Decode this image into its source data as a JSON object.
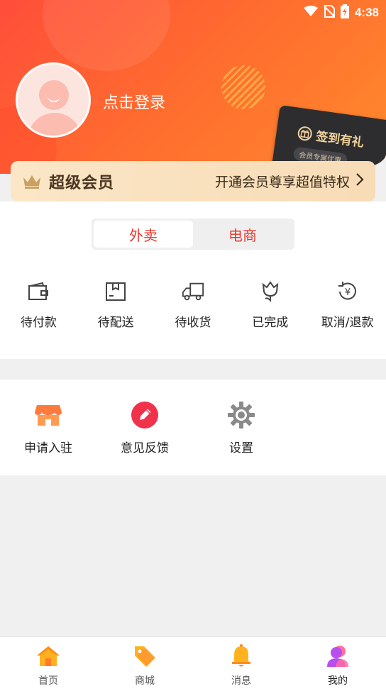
{
  "status_bar": {
    "time": "4:38"
  },
  "profile": {
    "login_text": "点击登录"
  },
  "sign_card": {
    "title": "签到有礼",
    "subtitle": "会员专属优惠"
  },
  "vip": {
    "title": "超级会员",
    "description": "开通会员尊享超值特权"
  },
  "order_tabs": [
    {
      "label": "外卖",
      "selected": true
    },
    {
      "label": "电商",
      "selected": false
    }
  ],
  "orders": [
    {
      "label": "待付款",
      "icon": "wallet-icon"
    },
    {
      "label": "待配送",
      "icon": "package-icon"
    },
    {
      "label": "待收货",
      "icon": "truck-icon"
    },
    {
      "label": "已完成",
      "icon": "flower-icon"
    },
    {
      "label": "取消/退款",
      "icon": "refund-icon"
    }
  ],
  "services": [
    {
      "label": "申请入驻",
      "icon": "shop-icon"
    },
    {
      "label": "意见反馈",
      "icon": "pencil-icon"
    },
    {
      "label": "设置",
      "icon": "gear-icon"
    }
  ],
  "nav": [
    {
      "label": "首页",
      "icon": "home-icon"
    },
    {
      "label": "商城",
      "icon": "tag-icon"
    },
    {
      "label": "消息",
      "icon": "bell-icon"
    },
    {
      "label": "我的",
      "icon": "user-icon",
      "active": true
    }
  ],
  "colors": {
    "brand": "#ff5a34",
    "accent_red": "#e8342c",
    "vip_gold": "#f7dcb6"
  }
}
